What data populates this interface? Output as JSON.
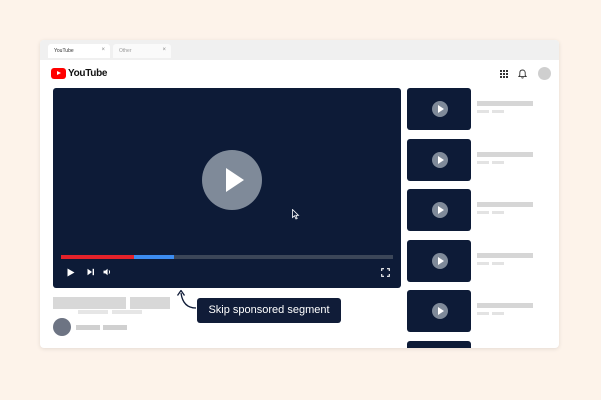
{
  "browser": {
    "tabs": [
      {
        "label": "YouTube",
        "active": true
      },
      {
        "label": "Other",
        "active": false
      }
    ],
    "tab_close_glyph": "×"
  },
  "site": {
    "logo_text": "YouTube",
    "brand_color": "#ff0000",
    "header_icons": [
      "apps-grid-icon",
      "bell-icon",
      "avatar"
    ]
  },
  "player": {
    "played_fraction": 0.22,
    "sponsor_segment_fraction": [
      0.22,
      0.34
    ],
    "progress_color": "#e4222a",
    "sponsor_color": "#3c8cf0",
    "controls": [
      "play-icon",
      "next-icon",
      "volume-icon",
      "fullscreen-icon"
    ]
  },
  "tooltip": {
    "text": "Skip sponsored segment"
  },
  "recommendations_count": 6
}
